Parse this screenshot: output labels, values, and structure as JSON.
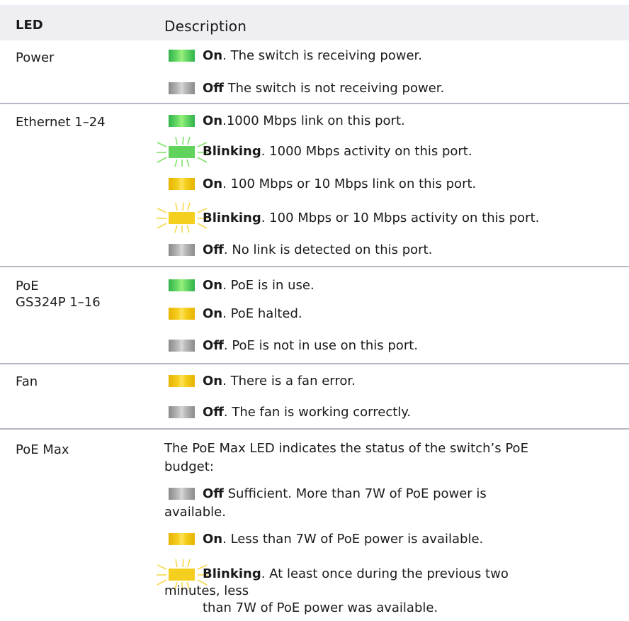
{
  "header": {
    "led_col": "LED",
    "desc_col": "Description"
  },
  "rows": {
    "power": {
      "label": "Power",
      "lines": [
        {
          "bold": "On",
          "text": ". The switch is receiving power."
        },
        {
          "bold": "Off",
          "text": " The switch is not receiving power."
        }
      ]
    },
    "ethernet": {
      "label": "Ethernet 1–24",
      "lines": [
        {
          "bold": "On",
          "text": ".1000 Mbps link on this port."
        },
        {
          "bold": "Blinking",
          "text": ". 1000 Mbps activity on this port."
        },
        {
          "bold": "On",
          "text": ". 100 Mbps or 10 Mbps link on this port."
        },
        {
          "bold": "Blinking",
          "text": ". 100 Mbps or 10 Mbps activity on this port."
        },
        {
          "bold": "Off",
          "text": ". No link is detected on this port."
        }
      ]
    },
    "poe": {
      "label1": "PoE",
      "label2": "GS324P 1–16",
      "lines": [
        {
          "bold": "On",
          "text": ". PoE is in use."
        },
        {
          "bold": "On",
          "text": ". PoE halted."
        },
        {
          "bold": "Off",
          "text": ". PoE is not in use on this port."
        }
      ]
    },
    "fan": {
      "label": "Fan",
      "lines": [
        {
          "bold": "On",
          "text": ". There is a fan error."
        },
        {
          "bold": "Off",
          "text": ". The fan is working correctly."
        }
      ]
    },
    "poemax": {
      "label": "PoE Max",
      "intro1": "The PoE Max LED indicates the status of the switch’s PoE",
      "intro2": "budget:",
      "off": {
        "bold": "Off",
        "text": " Sufficient. More than 7W of PoE power is",
        "cont": "available."
      },
      "on": {
        "bold": "On",
        "text": ". Less than 7W of PoE power is available."
      },
      "blink": {
        "bold": "Blinking",
        "text": ". At least once during the previous two",
        "cont1": "minutes, less",
        "cont2": "than 7W of PoE power was available."
      }
    }
  },
  "colors": {
    "header_bg": "#eeeef3",
    "separator": "#b7b7c4",
    "led_green": "#5fd35c",
    "led_yellow": "#f5cf1e",
    "led_gray": "#b9b9b9"
  }
}
